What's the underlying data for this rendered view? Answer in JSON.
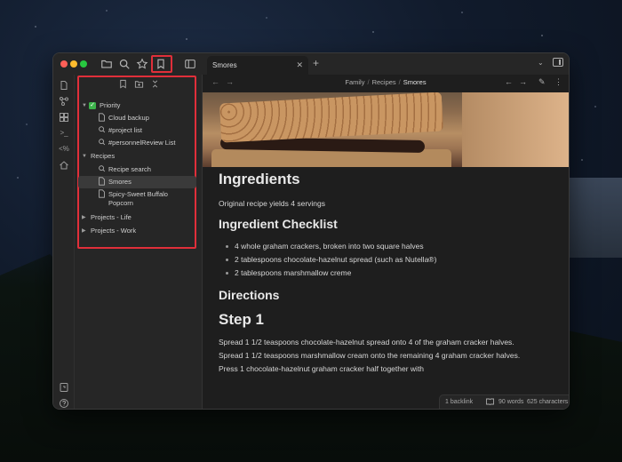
{
  "window": {
    "tab_title": "Smores",
    "close_glyph": "✕",
    "newtab_glyph": "+"
  },
  "titlebar_icons": [
    "folder-icon",
    "search-icon",
    "star-icon",
    "bookmark-icon",
    "sidebar-toggle-icon"
  ],
  "ribbon_icons": [
    "file-icon",
    "graph-icon",
    "layout-icon",
    "terminal-icon",
    "percent-code-icon",
    "home-icon",
    "help-book-icon",
    "help-icon",
    "gear-icon"
  ],
  "ribbon_glyphs": {
    "terminal": ">_",
    "percent_code": "<%"
  },
  "sidebar": {
    "tools": [
      "bookmark-add-icon",
      "folder-add-icon",
      "collapse-icon"
    ],
    "items": [
      {
        "label": "Priority",
        "type": "group",
        "checked": true
      },
      {
        "label": "Cloud backup",
        "type": "file"
      },
      {
        "label": "#project list",
        "type": "search"
      },
      {
        "label": "#personnelReview List",
        "type": "search"
      },
      {
        "label": "Recipes",
        "type": "group"
      },
      {
        "label": "Recipe search",
        "type": "search"
      },
      {
        "label": "Smores",
        "type": "file",
        "active": true
      },
      {
        "label": "Spicy-Sweet Buffalo",
        "label2": "Popcorn",
        "type": "file"
      },
      {
        "label": "Projects - Life",
        "type": "group-collapsed"
      },
      {
        "label": "Projects - Work",
        "type": "group-collapsed"
      }
    ]
  },
  "breadcrumb": {
    "part1": "Family",
    "part2": "Recipes",
    "current": "Smores",
    "sep": "/"
  },
  "nav": {
    "back": "←",
    "forward": "→"
  },
  "doc": {
    "heading1": "Ingredients",
    "intro": "Original recipe yields 4 servings",
    "heading2": "Ingredient Checklist",
    "bullets": [
      "4 whole graham crackers, broken into two square halves",
      "2 tablespoons chocolate-hazelnut spread (such as Nutella®)",
      "2 tablespoons marshmallow creme"
    ],
    "heading3": "Directions",
    "heading4": "Step 1",
    "steps": [
      "Spread 1 1/2 teaspoons chocolate-hazelnut spread onto 4 of the graham cracker halves.",
      "Spread 1 1/2 teaspoons marshmallow cream onto the remaining 4 graham cracker halves.",
      "Press 1 chocolate-hazelnut graham cracker half together with"
    ]
  },
  "status": {
    "backlinks": "1 backlink",
    "words": "90 words",
    "chars": "625 characters"
  },
  "colors": {
    "accent_red": "#e02f3a",
    "checkbox_green": "#3cb34a"
  }
}
